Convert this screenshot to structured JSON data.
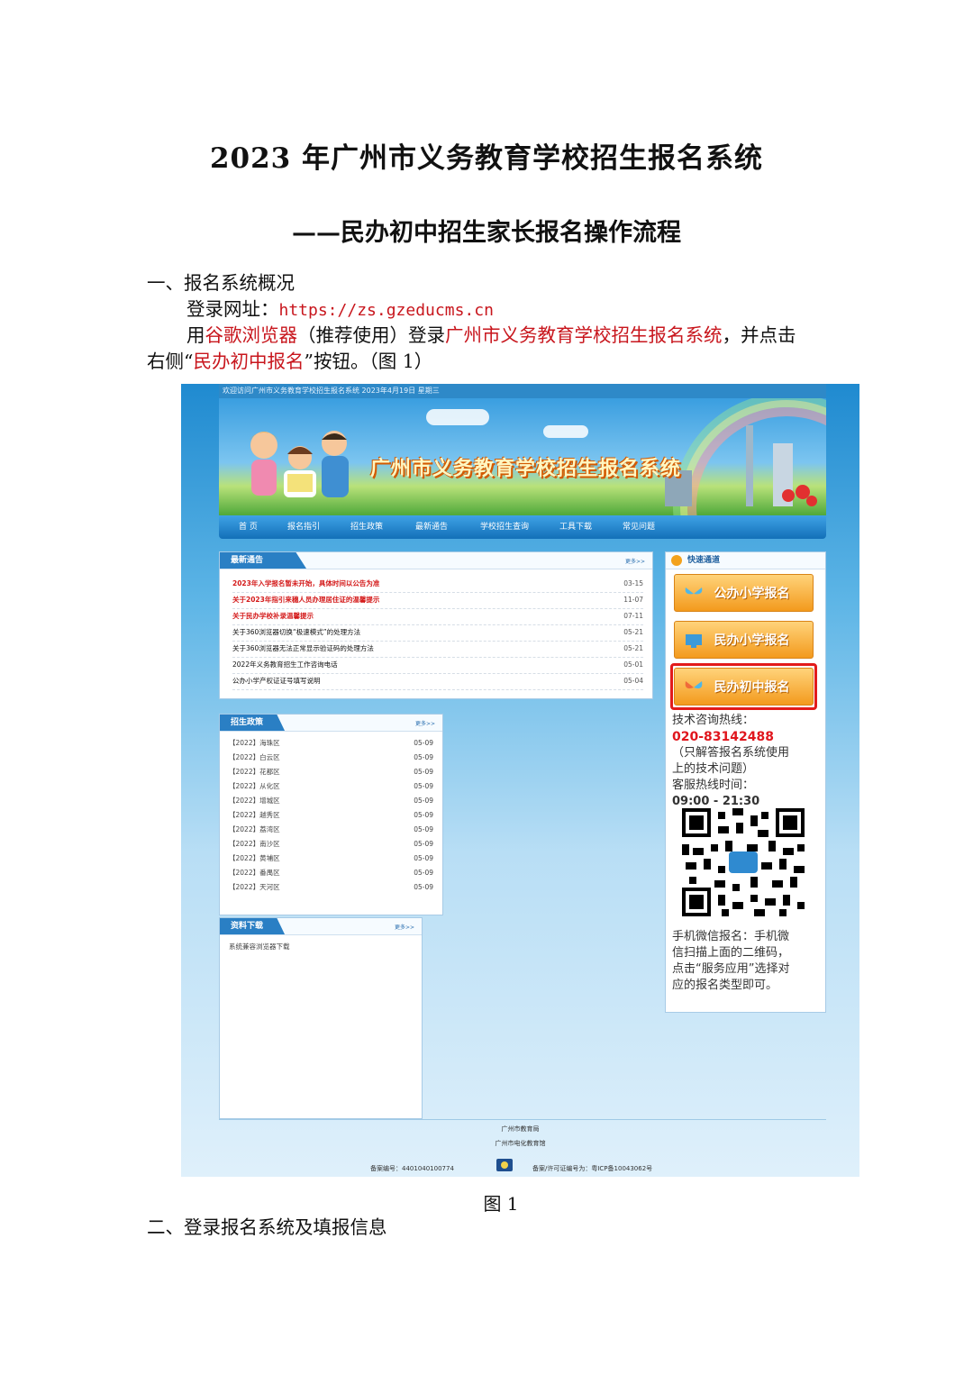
{
  "doc": {
    "title": "2023 年广州市义务教育学校招生报名系统",
    "subtitle": "——民办初中招生家长报名操作流程",
    "section1": "一、报名系统概况",
    "login_label": "登录网址：",
    "login_url": "https://zs.gzeducms.cn",
    "p1_a": "用",
    "p1_browser": "谷歌浏览器",
    "p1_b": "（推荐使用）登录",
    "p1_system": "广州市义务教育学校招生报名系统",
    "p1_c": "，并点击",
    "p2_a": "右侧“",
    "p2_button": "民办初中报名",
    "p2_b": "”按钮。（图 1）",
    "caption": "图 1",
    "section2": "二、登录报名系统及填报信息"
  },
  "site": {
    "top_strip": "欢迎访问广州市义务教育学校招生报名系统 2023年4月19日 星期三",
    "banner_title": "广州市义务教育学校招生报名系统",
    "nav": [
      "首 页",
      "报名指引",
      "招生政策",
      "最新通告",
      "学校招生查询",
      "工具下载",
      "常见问题"
    ],
    "notices": {
      "title": "最新通告",
      "more": "更多>>",
      "items": [
        {
          "text": "2023年入学报名暂未开始，具体时间以公告为准",
          "date": "03-15",
          "hot": true
        },
        {
          "text": "关于2023年指引来穗人员办理居住证的温馨提示",
          "date": "11-07",
          "hot": true
        },
        {
          "text": "关于民办学校补录温馨提示",
          "date": "07-11",
          "hot": true
        },
        {
          "text": "关于360浏览器切换“极速模式”的处理方法",
          "date": "05-21",
          "hot": false
        },
        {
          "text": "关于360浏览器无法正常显示验证码的处理方法",
          "date": "05-21",
          "hot": false
        },
        {
          "text": "2022年义务教育招生工作咨询电话",
          "date": "05-01",
          "hot": false
        },
        {
          "text": "公办小学产权证证号填写说明",
          "date": "05-04",
          "hot": false
        }
      ]
    },
    "policy": {
      "title": "招生政策",
      "more": "更多>>",
      "items": [
        {
          "text": "【2022】海珠区",
          "date": "05-09"
        },
        {
          "text": "【2022】白云区",
          "date": "05-09"
        },
        {
          "text": "【2022】花都区",
          "date": "05-09"
        },
        {
          "text": "【2022】从化区",
          "date": "05-09"
        },
        {
          "text": "【2022】增城区",
          "date": "05-09"
        },
        {
          "text": "【2022】越秀区",
          "date": "05-09"
        },
        {
          "text": "【2022】荔湾区",
          "date": "05-09"
        },
        {
          "text": "【2022】南沙区",
          "date": "05-09"
        },
        {
          "text": "【2022】黄埔区",
          "date": "05-09"
        },
        {
          "text": "【2022】番禺区",
          "date": "05-09"
        },
        {
          "text": "【2022】天河区",
          "date": "05-09"
        }
      ]
    },
    "downloads": {
      "title": "资料下载",
      "more": "更多>>",
      "items": [
        "系统兼容浏览器下载"
      ]
    },
    "quick": {
      "title": "快速通道",
      "btn_public_primary": "公办小学报名",
      "btn_private_primary": "民办小学报名",
      "btn_private_junior": "民办初中报名",
      "hotline_label": "技术咨询热线：",
      "hotline": "020-83142488",
      "note_1": "（只解答报名系统使用",
      "note_2": "上的技术问题）",
      "hours_label": "客服热线时间：",
      "hours": "09:00 - 21:30",
      "wx_1": "手机微信报名：手机微",
      "wx_2": "信扫描上面的二维码，",
      "wx_3": "点击“服务应用”选择对",
      "wx_4": "应的报名类型即可。"
    },
    "footer": {
      "org_1": "广州市教育局",
      "org_2": "广州市电化教育馆",
      "record_no": "备案编号：4401040100774",
      "icp": "备案/许可证编号为：粤ICP备10043062号"
    },
    "colors": {
      "accent": "#2a7fc4",
      "highlight": "#e21b1b",
      "button": "#f39a1d"
    }
  }
}
